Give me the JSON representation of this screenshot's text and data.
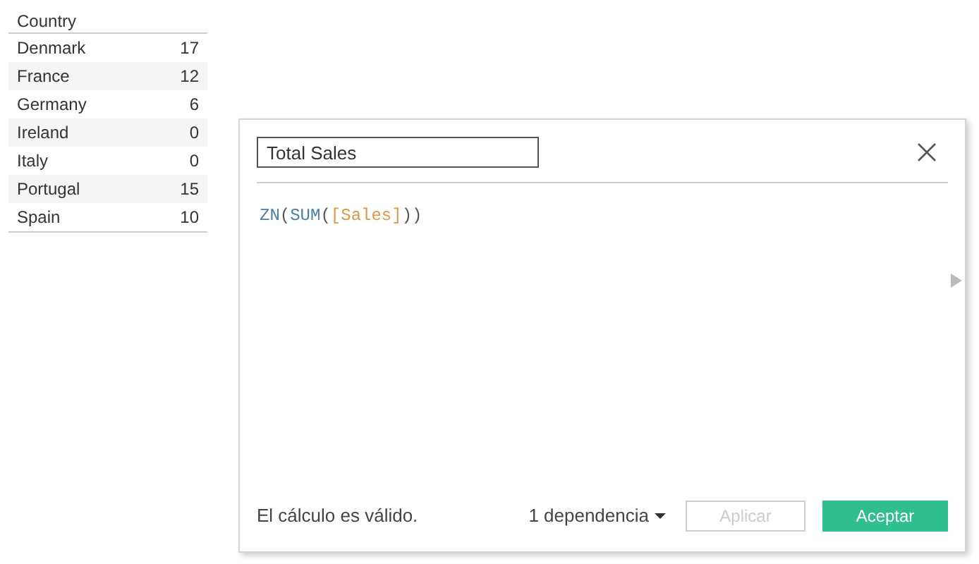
{
  "table": {
    "header": "Country",
    "rows": [
      {
        "country": "Denmark",
        "value": "17"
      },
      {
        "country": "France",
        "value": "12"
      },
      {
        "country": "Germany",
        "value": "6"
      },
      {
        "country": "Ireland",
        "value": "0"
      },
      {
        "country": "Italy",
        "value": "0"
      },
      {
        "country": "Portugal",
        "value": "15"
      },
      {
        "country": "Spain",
        "value": "10"
      }
    ]
  },
  "dialog": {
    "name_field": {
      "value": "Total Sales"
    },
    "formula": [
      {
        "kind": "function",
        "text": "ZN"
      },
      {
        "kind": "paren",
        "text": "("
      },
      {
        "kind": "function",
        "text": "SUM"
      },
      {
        "kind": "paren",
        "text": "("
      },
      {
        "kind": "field",
        "text": "[Sales]"
      },
      {
        "kind": "paren",
        "text": "))"
      }
    ],
    "status": "El cálculo es válido.",
    "dependencies": "1 dependencia",
    "apply_button": {
      "label": "Aplicar",
      "disabled": true
    },
    "ok_button": {
      "label": "Aceptar",
      "disabled": false
    }
  }
}
